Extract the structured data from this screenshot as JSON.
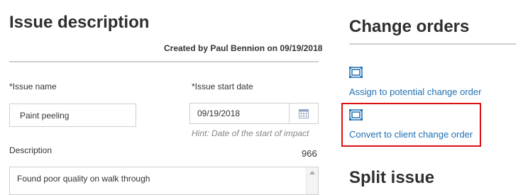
{
  "issue_section": {
    "title": "Issue description",
    "created_by": "Created by Paul Bennion on 09/19/2018",
    "issue_name_label": "*Issue name",
    "issue_name_value": "Paint peeling",
    "start_date_label": "*Issue start date",
    "start_date_value": "09/19/2018",
    "start_date_hint": "Hint: Date of the start of impact",
    "description_label": "Description",
    "char_count": "966",
    "description_value": "Found poor quality on walk through"
  },
  "change_orders": {
    "title": "Change orders",
    "assign_link": "Assign to potential change order",
    "convert_link": "Convert to client change order",
    "icon": "change-order-icon",
    "link_color": "#1f6fb2",
    "highlight_color": "#e01010"
  },
  "split_issue": {
    "title": "Split issue"
  }
}
